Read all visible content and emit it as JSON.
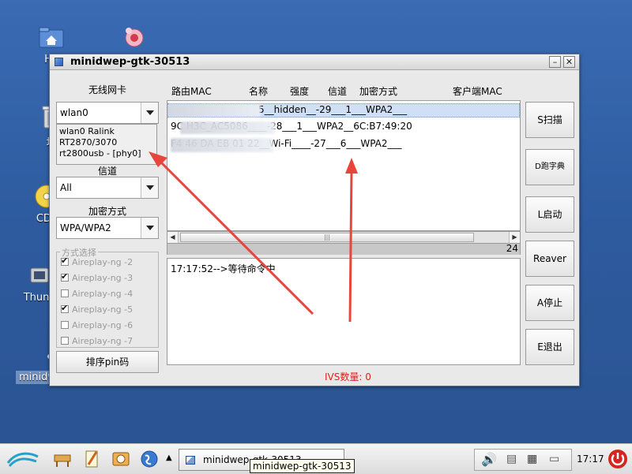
{
  "desktop": {
    "icons": [
      {
        "name": "home",
        "label": "Ho"
      },
      {
        "name": "trash",
        "label": "垃"
      },
      {
        "name": "cdl",
        "label": "CDL"
      },
      {
        "name": "thunar",
        "label": "Thuna"
      },
      {
        "name": "minidwep-shortcut",
        "label": "minidwep-gtk"
      }
    ]
  },
  "window": {
    "title": "minidwep-gtk-30513",
    "min_glyph": "–",
    "close_glyph": "✕"
  },
  "left": {
    "wireless_label": "无线网卡",
    "wireless_value": "wlan0",
    "dropdown_lines": [
      "wlan0 Ralink",
      "RT2870/3070",
      "rt2800usb - [phy0]"
    ],
    "channel_label": "信道",
    "channel_value": "All",
    "encryption_label": "加密方式",
    "encryption_value": "WPA/WPA2",
    "method_title": "方式选择",
    "methods": [
      {
        "label": "Aireplay-ng -2",
        "checked": true
      },
      {
        "label": "Aireplay-ng -3",
        "checked": true
      },
      {
        "label": "Aireplay-ng -4",
        "checked": false
      },
      {
        "label": "Aireplay-ng -5",
        "checked": true
      },
      {
        "label": "Aireplay-ng -6",
        "checked": false
      },
      {
        "label": "Aireplay-ng -7",
        "checked": false
      }
    ],
    "sort_pin_button": "排序pin码"
  },
  "list": {
    "headers": [
      "路由MAC",
      "名称",
      "强度",
      "信道",
      "加密方式",
      "客户端MAC"
    ],
    "rows": [
      "5__hidden__-29___1___WPA2___",
      "9C               H3C_AC5086____-28___1___WPA2__6C:B7:49:20",
      "F4 46 DA EB 01 22__Wi-Fi____-27___6___WPA2___"
    ],
    "count": "24"
  },
  "log": {
    "line": "17:17:52-->等待命令中"
  },
  "ivs_label": "IVS数量: 0",
  "buttons": {
    "scan": "S扫描",
    "dict": "D跑字典",
    "start": "L启动",
    "reaver": "Reaver",
    "stop": "A停止",
    "exit": "E退出"
  },
  "taskbar": {
    "task_title": "minidwep-gtk-30513",
    "tooltip": "minidwep-gtk-30513",
    "clock": "17:17"
  },
  "colors": {
    "desktop": "#2f5a9c",
    "selection": "#cfe0f6",
    "arrow": "#e8453c",
    "ivs_text": "#e0201e"
  }
}
